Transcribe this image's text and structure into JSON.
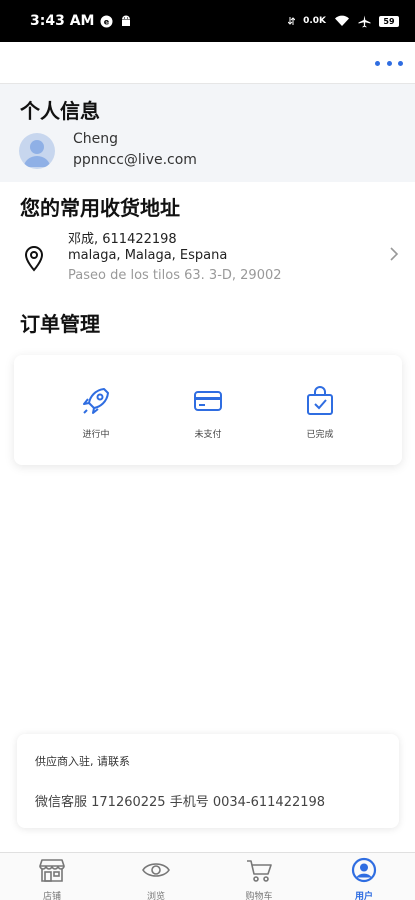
{
  "status_bar": {
    "time": "3:43 AM",
    "network_speed": "0.0K",
    "battery": "59",
    "icons": [
      "notification-icon",
      "android-icon",
      "speed-icon",
      "wifi-icon",
      "airplane-icon",
      "battery-icon"
    ]
  },
  "header": {
    "more_icon": "more-dots-icon",
    "accent_color": "#2f6de1"
  },
  "profile": {
    "section_title": "个人信息",
    "name": "Cheng",
    "email": "ppnncc@live.com"
  },
  "address": {
    "section_title": "您的常用收货地址",
    "line1": "邓成, 611422198",
    "line2": "malaga, Malaga, Espana",
    "line3": "Paseo de los tilos 63. 3-D, 29002"
  },
  "orders": {
    "section_title": "订单管理",
    "items": [
      {
        "label": "进行中",
        "icon": "rocket-icon"
      },
      {
        "label": "未支付",
        "icon": "card-icon"
      },
      {
        "label": "已完成",
        "icon": "completed-bag-icon"
      }
    ]
  },
  "supplier": {
    "title": "供应商入驻, 请联系",
    "contact": "微信客服 171260225 手机号 0034-611422198"
  },
  "bottom_nav": {
    "items": [
      {
        "label": "店铺",
        "icon": "store-icon",
        "active": false
      },
      {
        "label": "浏览",
        "icon": "eye-icon",
        "active": false
      },
      {
        "label": "购物车",
        "icon": "cart-icon",
        "active": false
      },
      {
        "label": "用户",
        "icon": "user-icon",
        "active": true
      }
    ],
    "active_color": "#2f6de1"
  }
}
